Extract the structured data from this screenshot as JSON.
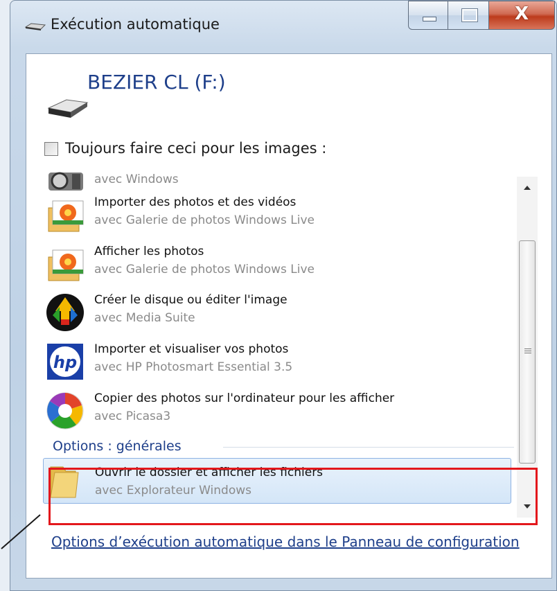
{
  "window": {
    "title": "Exécution automatique",
    "controls": {
      "minimize": "minimize",
      "maximize": "maximize",
      "close": "X"
    }
  },
  "drive": {
    "title": "BEZIER CL (F:)"
  },
  "always_checkbox": {
    "label": "Toujours faire ceci pour les images :",
    "checked": false
  },
  "list": {
    "items": [
      {
        "title": "",
        "subtitle": "avec Windows",
        "icon": "camera-icon"
      },
      {
        "title": "Importer des photos et des vidéos",
        "subtitle": "avec Galerie de photos Windows Live",
        "icon": "photo-gallery-icon"
      },
      {
        "title": "Afficher les photos",
        "subtitle": "avec Galerie de photos Windows Live",
        "icon": "photo-gallery-icon"
      },
      {
        "title": "Créer le disque ou éditer l'image",
        "subtitle": "avec Media Suite",
        "icon": "media-suite-icon"
      },
      {
        "title": "Importer et visualiser vos photos",
        "subtitle": "avec HP Photosmart Essential 3.5",
        "icon": "hp-icon"
      },
      {
        "title": "Copier des photos sur l'ordinateur pour les afficher",
        "subtitle": "avec Picasa3",
        "icon": "picasa-icon"
      }
    ],
    "section_label": "Options : générales",
    "selected_item": {
      "title": "Ouvrir le dossier et afficher les fichiers",
      "subtitle": "avec Explorateur Windows",
      "icon": "folder-icon"
    }
  },
  "footer": {
    "link": "Options d’exécution automatique dans le Panneau de configuration"
  },
  "colors": {
    "accent": "#1e3f8a",
    "highlight": "#e3171c"
  }
}
